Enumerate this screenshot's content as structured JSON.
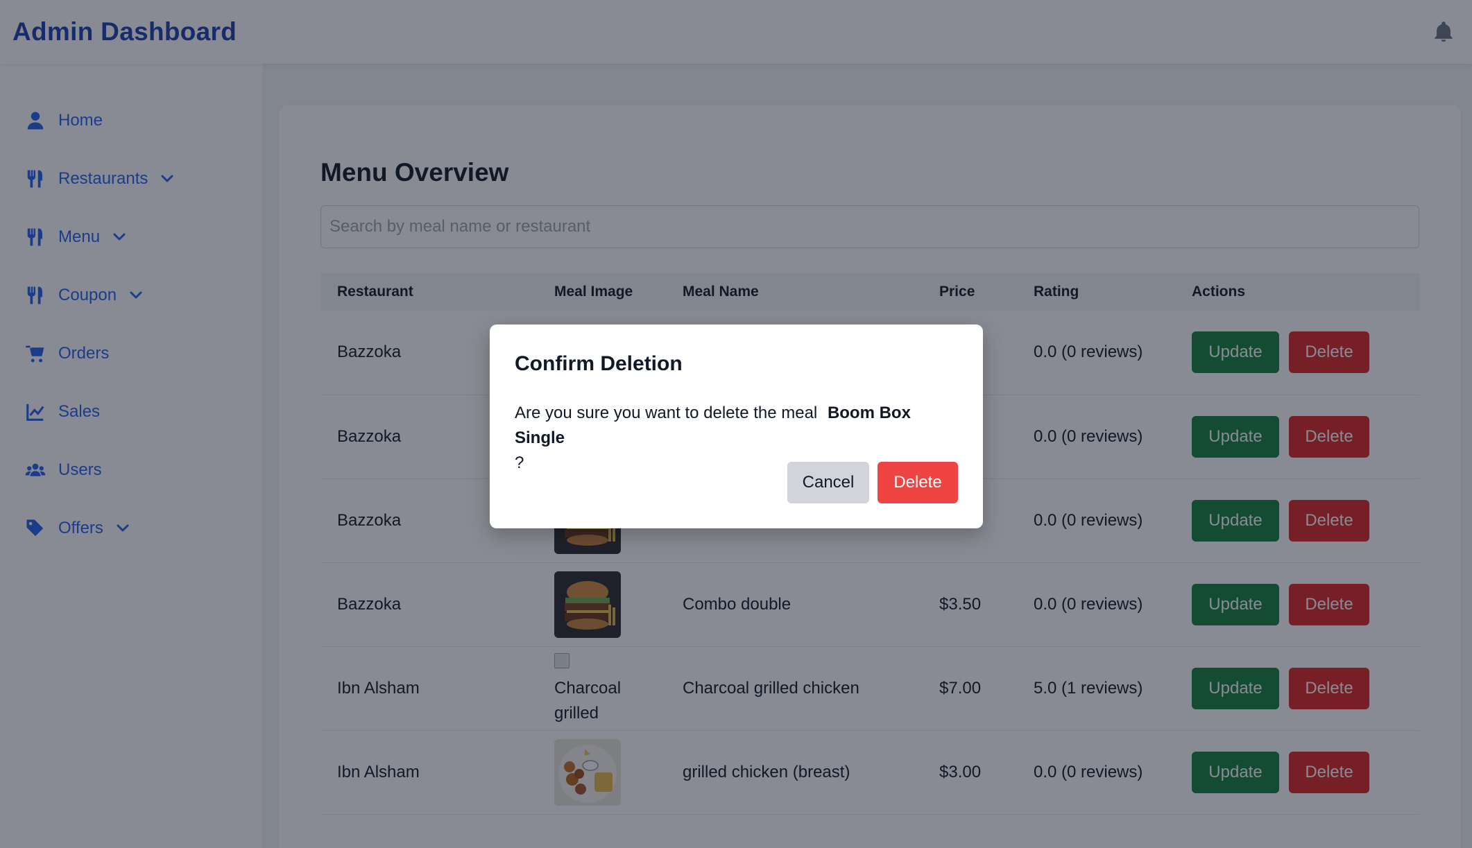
{
  "header": {
    "title": "Admin Dashboard",
    "bell_icon": "bell-icon"
  },
  "sidebar": {
    "items": [
      {
        "label": "Home",
        "icon": "user-icon",
        "expandable": false
      },
      {
        "label": "Restaurants",
        "icon": "utensils-icon",
        "expandable": true
      },
      {
        "label": "Menu",
        "icon": "utensils-icon",
        "expandable": true
      },
      {
        "label": "Coupon",
        "icon": "utensils-icon",
        "expandable": true
      },
      {
        "label": "Orders",
        "icon": "cart-icon",
        "expandable": false
      },
      {
        "label": "Sales",
        "icon": "chart-line-icon",
        "expandable": false
      },
      {
        "label": "Users",
        "icon": "users-icon",
        "expandable": false
      },
      {
        "label": "Offers",
        "icon": "tags-icon",
        "expandable": true
      }
    ]
  },
  "main": {
    "title": "Menu Overview",
    "search": {
      "placeholder": "Search by meal name or restaurant",
      "value": ""
    },
    "table": {
      "headers": [
        "Restaurant",
        "Meal Image",
        "Meal Name",
        "Price",
        "Rating",
        "Actions"
      ],
      "rows": [
        {
          "restaurant": "Bazzoka",
          "image": "",
          "image_alt": "",
          "meal": "",
          "price": "",
          "rating": "0.0 (0 reviews)"
        },
        {
          "restaurant": "Bazzoka",
          "image": "",
          "image_alt": "",
          "meal": "",
          "price": "",
          "rating": "0.0 (0 reviews)"
        },
        {
          "restaurant": "Bazzoka",
          "image": "burger",
          "image_alt": "",
          "meal": "",
          "price": "",
          "rating": "0.0 (0 reviews)"
        },
        {
          "restaurant": "Bazzoka",
          "image": "burger",
          "image_alt": "",
          "meal": "Combo double",
          "price": "$3.50",
          "rating": "0.0 (0 reviews)"
        },
        {
          "restaurant": "Ibn Alsham",
          "image": "broken",
          "image_alt": "Charcoal grilled",
          "meal": "Charcoal grilled chicken",
          "price": "$7.00",
          "rating": "5.0 (1 reviews)"
        },
        {
          "restaurant": "Ibn Alsham",
          "image": "chicken",
          "image_alt": "",
          "meal": "grilled chicken (breast)",
          "price": "$3.00",
          "rating": "0.0 (0 reviews)"
        }
      ],
      "update_label": "Update",
      "delete_label": "Delete"
    }
  },
  "modal": {
    "title": "Confirm Deletion",
    "message": "Are you sure you want to delete the meal",
    "meal_name": "Boom Box Single",
    "suffix": "?",
    "cancel_label": "Cancel",
    "confirm_label": "Delete"
  },
  "colors": {
    "brand": "#1e40af",
    "nav": "#2563eb",
    "update": "#15803d",
    "delete": "#dc2626",
    "modal_delete": "#ef4444"
  }
}
